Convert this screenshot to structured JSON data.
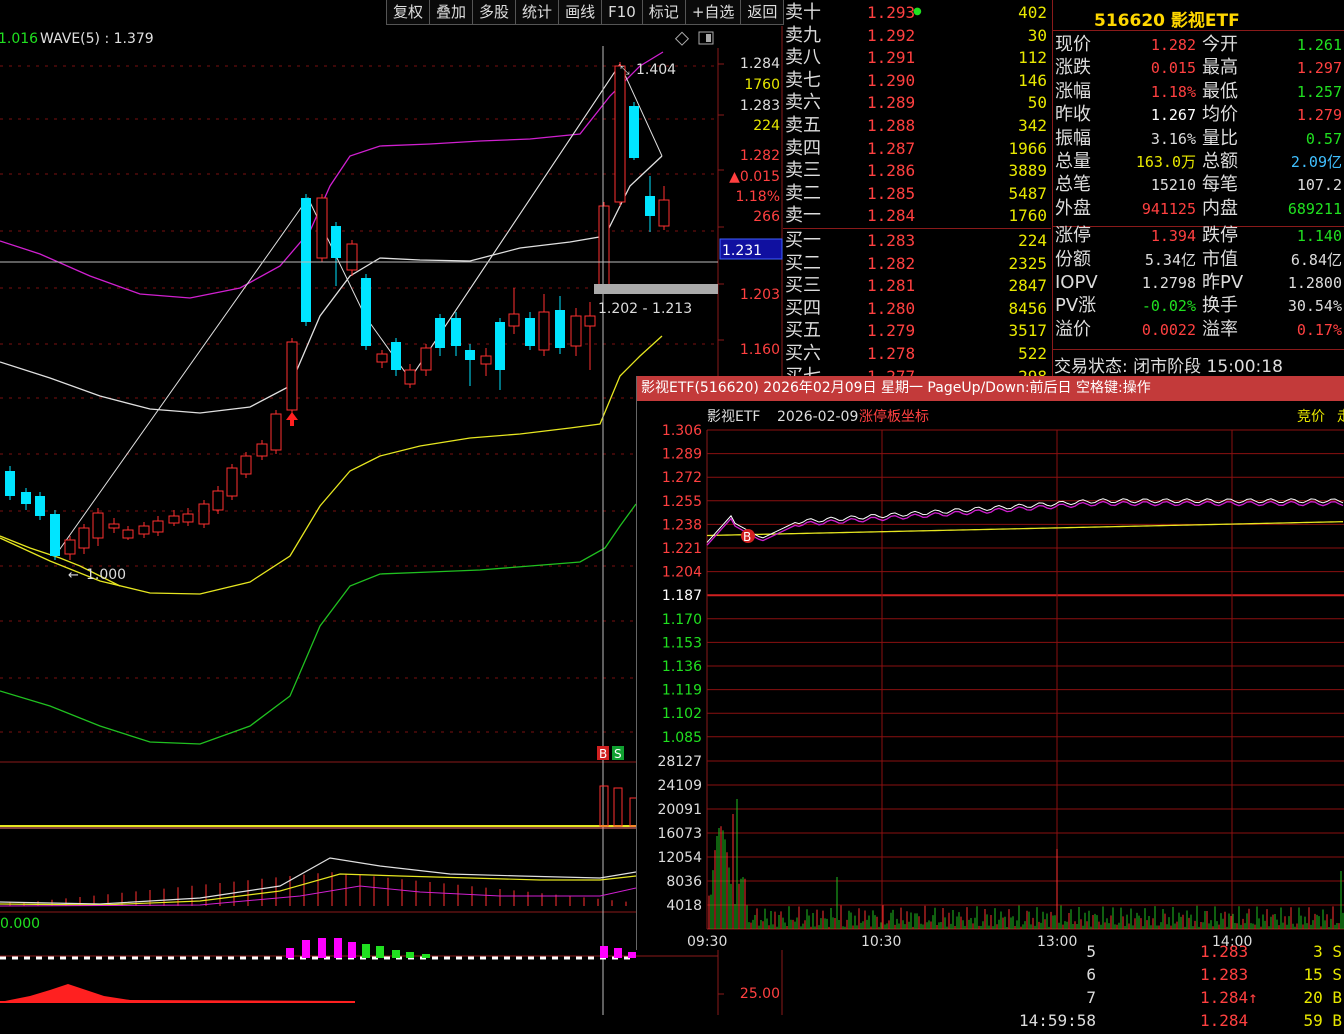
{
  "toolbar": {
    "items": [
      "复权",
      "叠加",
      "多股",
      "统计",
      "画线",
      "F10",
      "标记",
      "+自选",
      "返回"
    ]
  },
  "kline": {
    "wave_label": "WAVE(5) : 1.379",
    "left_partial": "1.016",
    "high_label": "1.404",
    "low_label": "1.000",
    "range_label": "1.202 - 1.213",
    "current_price_tag": "1.231",
    "bs_b": "B",
    "bs_s": "S",
    "sub_label": "0.000",
    "axis_labels": [
      "1.284",
      "1760",
      "1.283",
      "224",
      "1.282",
      "▲0.015",
      "1.18%",
      "266",
      "1.203",
      "1.160",
      "25.00"
    ],
    "colors": {
      "up": "#ff3030",
      "down": "#00e5ff",
      "ma_magenta": "#d020d0",
      "ma_white": "#e0e0e0",
      "ma_yellow": "#e6e620",
      "ma_green": "#20c020"
    }
  },
  "orderbook": {
    "asks": [
      {
        "name": "卖十",
        "price": "1.293",
        "vol": "402"
      },
      {
        "name": "卖九",
        "price": "1.292",
        "vol": "30"
      },
      {
        "name": "卖八",
        "price": "1.291",
        "vol": "112"
      },
      {
        "name": "卖七",
        "price": "1.290",
        "vol": "146"
      },
      {
        "name": "卖六",
        "price": "1.289",
        "vol": "50"
      },
      {
        "name": "卖五",
        "price": "1.288",
        "vol": "342"
      },
      {
        "name": "卖四",
        "price": "1.287",
        "vol": "1966"
      },
      {
        "name": "卖三",
        "price": "1.286",
        "vol": "3889"
      },
      {
        "name": "卖二",
        "price": "1.285",
        "vol": "5487"
      },
      {
        "name": "卖一",
        "price": "1.284",
        "vol": "1760"
      }
    ],
    "bids": [
      {
        "name": "买一",
        "price": "1.283",
        "vol": "224"
      },
      {
        "name": "买二",
        "price": "1.282",
        "vol": "2325"
      },
      {
        "name": "买三",
        "price": "1.281",
        "vol": "2847"
      },
      {
        "name": "买四",
        "price": "1.280",
        "vol": "8456"
      },
      {
        "name": "买五",
        "price": "1.279",
        "vol": "3517"
      },
      {
        "name": "买六",
        "price": "1.278",
        "vol": "522"
      },
      {
        "name": "买七",
        "price": "1.277",
        "vol": "298"
      }
    ]
  },
  "quote": {
    "title": "516620 影视ETF",
    "rows": [
      {
        "l1": "现价",
        "v1": "1.282",
        "c1": "#ff4040",
        "l2": "今开",
        "v2": "1.261",
        "c2": "#20e020"
      },
      {
        "l1": "涨跌",
        "v1": "0.015",
        "c1": "#ff4040",
        "l2": "最高",
        "v2": "1.297",
        "c2": "#ff4040"
      },
      {
        "l1": "涨幅",
        "v1": "1.18%",
        "c1": "#ff4040",
        "l2": "最低",
        "v2": "1.257",
        "c2": "#20e020"
      },
      {
        "l1": "昨收",
        "v1": "1.267",
        "c1": "#ffffff",
        "l2": "均价",
        "v2": "1.279",
        "c2": "#ff4040"
      },
      {
        "l1": "振幅",
        "v1": "3.16%",
        "c1": "#dddddd",
        "l2": "量比",
        "v2": "0.57",
        "c2": "#20e020"
      },
      {
        "l1": "总量",
        "v1": "163.0万",
        "c1": "#e8e800",
        "l2": "总额",
        "v2": "2.09亿",
        "c2": "#40c0ff"
      },
      {
        "l1": "总笔",
        "v1": "15210",
        "c1": "#dddddd",
        "l2": "每笔",
        "v2": "107.2",
        "c2": "#dddddd"
      },
      {
        "l1": "外盘",
        "v1": "941125",
        "c1": "#ff4040",
        "l2": "内盘",
        "v2": "689211",
        "c2": "#20e020"
      },
      {
        "l1": "涨停",
        "v1": "1.394",
        "c1": "#ff4040",
        "l2": "跌停",
        "v2": "1.140",
        "c2": "#20e020"
      },
      {
        "l1": "份额",
        "v1": "5.34亿",
        "c1": "#dddddd",
        "l2": "市值",
        "v2": "6.84亿",
        "c2": "#dddddd"
      },
      {
        "l1": "IOPV",
        "v1": "1.2798",
        "c1": "#dddddd",
        "l2": "昨PV",
        "v2": "1.2800",
        "c2": "#dddddd"
      },
      {
        "l1": "PV涨",
        "v1": "-0.02%",
        "c1": "#20e020",
        "l2": "换手",
        "v2": "30.54%",
        "c2": "#dddddd"
      },
      {
        "l1": "溢价",
        "v1": "0.0022",
        "c1": "#ff4040",
        "l2": "溢率",
        "v2": "0.17%",
        "c2": "#ff4040"
      }
    ],
    "status": "交易状态: 闭市阶段 15:00:18"
  },
  "popup": {
    "title": "影视ETF(516620) 2026年02月09日 星期一 PageUp/Down:前后日 空格键:操作",
    "sub_name": "影视ETF",
    "sub_date": "2026-02-09",
    "sub_indicator": "涨停板坐标",
    "right_label": "竞价",
    "right_label2": "走",
    "price_ticks": [
      "1.306",
      "1.289",
      "1.272",
      "1.255",
      "1.238",
      "1.221",
      "1.204",
      "1.187",
      "1.170",
      "1.153",
      "1.136",
      "1.119",
      "1.102",
      "1.085"
    ],
    "vol_ticks": [
      "28127",
      "24109",
      "20091",
      "16073",
      "12054",
      "8036",
      "4018"
    ],
    "time_ticks": [
      "09:30",
      "10:30",
      "13:00",
      "14:00"
    ],
    "marker_b": "B"
  },
  "ticks": {
    "rows": [
      {
        "idx": "5",
        "price": "1.283",
        "tail": "3 S"
      },
      {
        "idx": "6",
        "price": "1.283",
        "tail": "15 S"
      },
      {
        "idx": "7",
        "price": "1.284↑",
        "tail": "20 B"
      },
      {
        "idx": "14:59:58",
        "price": "1.284",
        "tail": "59 B"
      }
    ]
  }
}
